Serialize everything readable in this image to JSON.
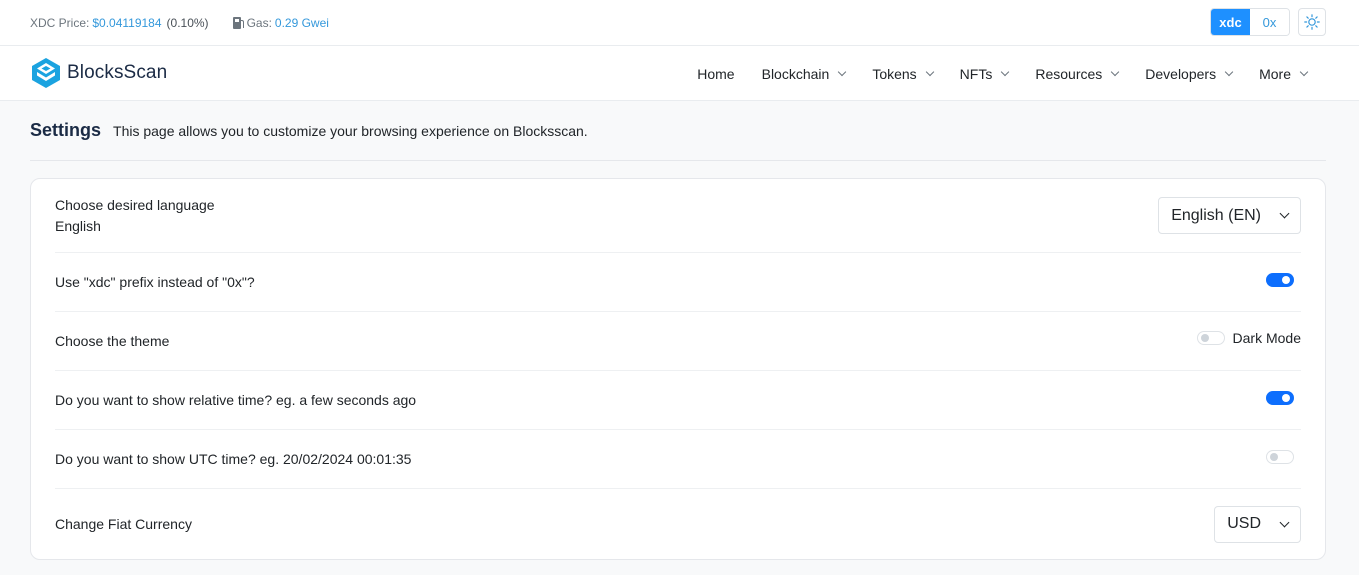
{
  "topbar": {
    "price_label": "XDC Price:",
    "price_value": "$0.04119184",
    "price_change": "(0.10%)",
    "gas_label": "Gas:",
    "gas_value": "0.29 Gwei",
    "prefix_options": [
      "xdc",
      "0x"
    ],
    "active_prefix": "xdc",
    "theme_icon": "sun-icon"
  },
  "brand": {
    "name": "BlocksScan",
    "colors": {
      "accent": "#1e90ff",
      "logo": "#1ba3e0",
      "toggle": "#0d6efd"
    }
  },
  "nav": {
    "items": [
      {
        "label": "Home",
        "dropdown": false
      },
      {
        "label": "Blockchain",
        "dropdown": true
      },
      {
        "label": "Tokens",
        "dropdown": true
      },
      {
        "label": "NFTs",
        "dropdown": true
      },
      {
        "label": "Resources",
        "dropdown": true
      },
      {
        "label": "Developers",
        "dropdown": true
      },
      {
        "label": "More",
        "dropdown": true
      }
    ]
  },
  "page": {
    "title": "Settings",
    "description": "This page allows you to customize your browsing experience on Blocksscan."
  },
  "settings": {
    "language": {
      "label": "Choose desired language",
      "current": "English",
      "selected": "English (EN)"
    },
    "prefix": {
      "label": "Use \"xdc\" prefix instead of \"0x\"?",
      "enabled": true
    },
    "theme": {
      "label": "Choose the theme",
      "toggle_label": "Dark Mode",
      "enabled": false
    },
    "relative_time": {
      "label": "Do you want to show relative time? eg. a few seconds ago",
      "enabled": true
    },
    "utc_time": {
      "label": "Do you want to show UTC time? eg. 20/02/2024 00:01:35",
      "enabled": false
    },
    "fiat": {
      "label": "Change Fiat Currency",
      "selected": "USD"
    }
  }
}
